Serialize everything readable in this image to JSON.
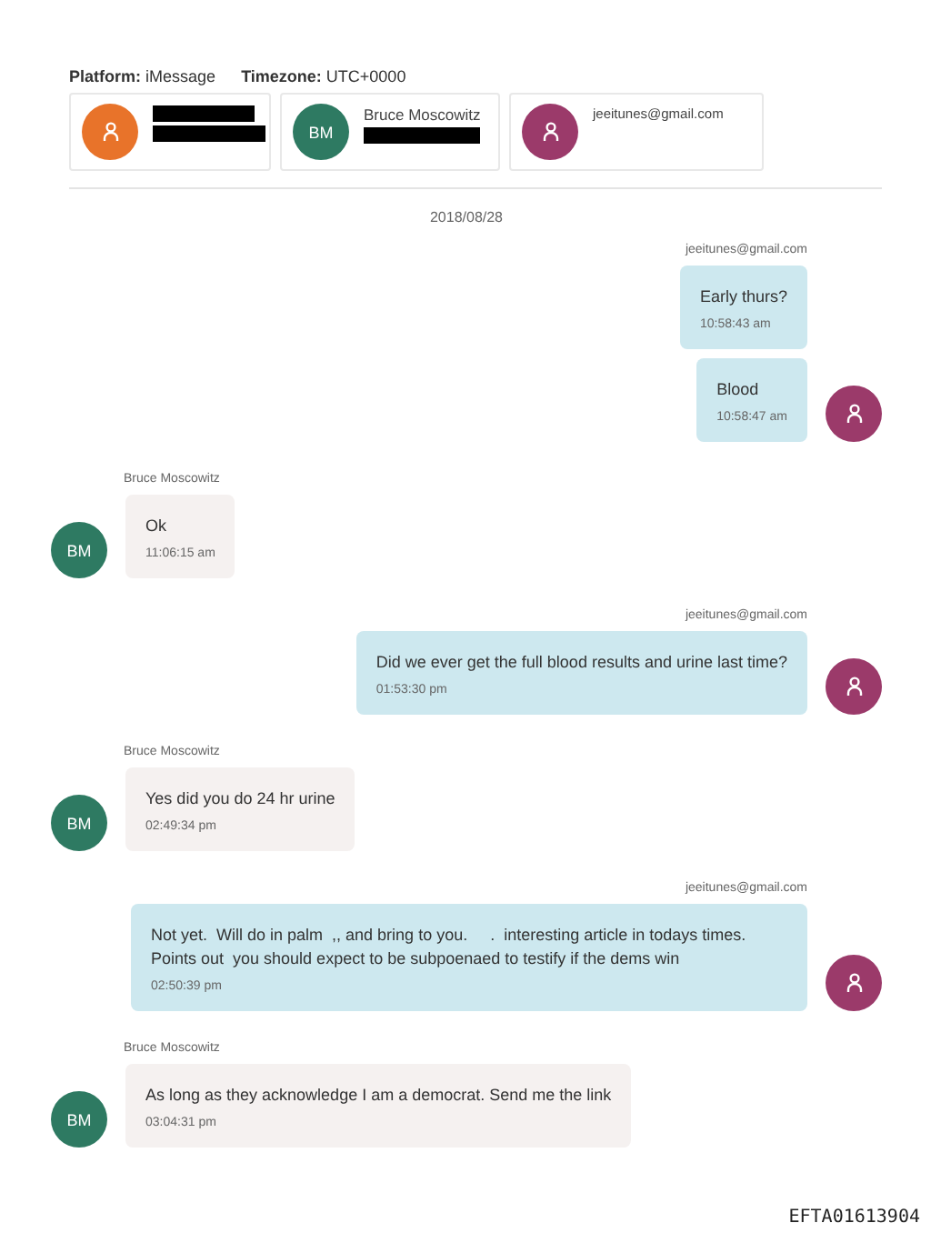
{
  "header": {
    "platform_label": "Platform:",
    "platform": "iMessage",
    "timezone_label": "Timezone:",
    "timezone": "UTC+0000"
  },
  "participants": [
    {
      "avatar": {
        "kind": "icon",
        "color": "#e8732a"
      },
      "name_redacted": true,
      "detail_redacted": true
    },
    {
      "avatar": {
        "kind": "initials",
        "text": "BM",
        "color": "#2e7a62"
      },
      "name": "Bruce Moscowitz",
      "detail_redacted": true
    },
    {
      "avatar": {
        "kind": "icon",
        "color": "#9b3a6a"
      },
      "name": "jeeitunes@gmail.com"
    }
  ],
  "date": "2018/08/28",
  "groups": [
    {
      "outgoing": true,
      "sender": "jeeitunes@gmail.com",
      "avatar": {
        "kind": "icon",
        "color": "#9b3a6a"
      },
      "messages": [
        {
          "text": "Early thurs?",
          "time": "10:58:43 am"
        },
        {
          "text": "Blood",
          "time": "10:58:47 am"
        }
      ]
    },
    {
      "outgoing": false,
      "sender": "Bruce Moscowitz",
      "avatar": {
        "kind": "initials",
        "text": "BM",
        "color": "#2e7a62"
      },
      "messages": [
        {
          "text": "Ok",
          "time": "11:06:15 am"
        }
      ]
    },
    {
      "outgoing": true,
      "sender": "jeeitunes@gmail.com",
      "avatar": {
        "kind": "icon",
        "color": "#9b3a6a"
      },
      "messages": [
        {
          "text": "Did we ever get the full blood results and urine last time?",
          "time": "01:53:30 pm"
        }
      ]
    },
    {
      "outgoing": false,
      "sender": "Bruce Moscowitz",
      "avatar": {
        "kind": "initials",
        "text": "BM",
        "color": "#2e7a62"
      },
      "messages": [
        {
          "text": "Yes did you do 24 hr urine",
          "time": "02:49:34 pm"
        }
      ]
    },
    {
      "outgoing": true,
      "sender": "jeeitunes@gmail.com",
      "avatar": {
        "kind": "icon",
        "color": "#9b3a6a"
      },
      "messages": [
        {
          "text": "Not yet.  Will do in palm  ,, and bring to you.     .  interesting article in todays times.  Points out  you should expect to be subpoenaed to testify if the dems win",
          "time": "02:50:39 pm"
        }
      ]
    },
    {
      "outgoing": false,
      "sender": "Bruce Moscowitz",
      "avatar": {
        "kind": "initials",
        "text": "BM",
        "color": "#2e7a62"
      },
      "messages": [
        {
          "text": "As long as they acknowledge I am a democrat. Send me the link",
          "time": "03:04:31 pm"
        }
      ]
    }
  ],
  "footer": "EFTA01613904"
}
